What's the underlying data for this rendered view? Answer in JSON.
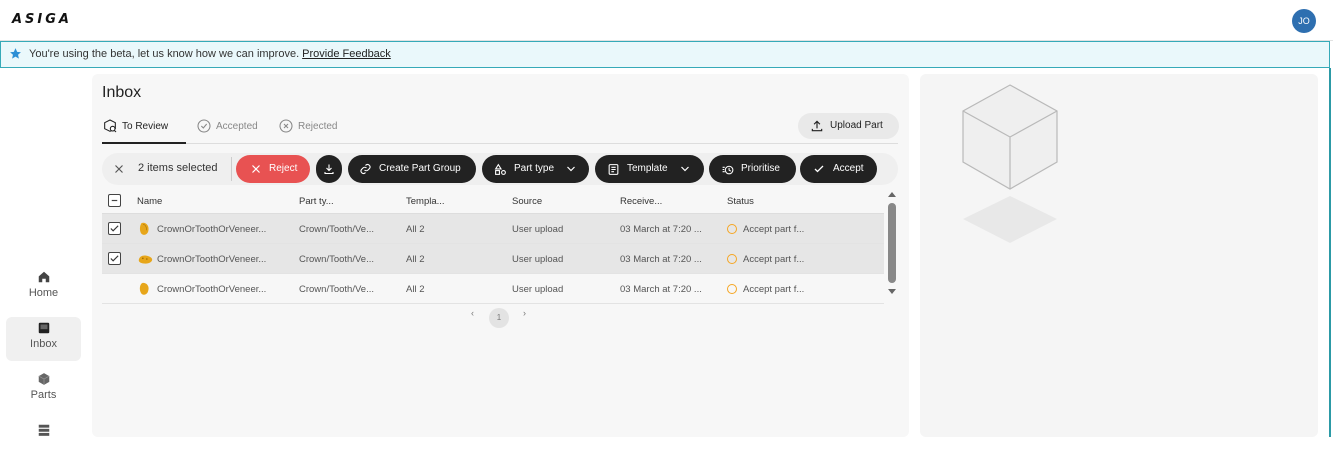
{
  "app": {
    "logo": "ASIGA",
    "user_initials": "JO"
  },
  "banner": {
    "message": "You're using the beta, let us know how we can improve.",
    "link": "Provide Feedback"
  },
  "sidebar": {
    "items": [
      {
        "label": "Home",
        "icon": "home-icon"
      },
      {
        "label": "Inbox",
        "icon": "inbox-icon",
        "active": true
      },
      {
        "label": "Parts",
        "icon": "cube-icon"
      },
      {
        "label": "",
        "icon": "server-icon"
      }
    ]
  },
  "main": {
    "title": "Inbox",
    "tabs": [
      {
        "label": "To Review",
        "active": true
      },
      {
        "label": "Accepted"
      },
      {
        "label": "Rejected"
      }
    ],
    "upload_label": "Upload Part",
    "actions": {
      "selected_count": "2 items selected",
      "reject": "Reject",
      "create_group": "Create Part Group",
      "part_type": "Part type",
      "template": "Template",
      "prioritise": "Prioritise",
      "accept": "Accept"
    },
    "table": {
      "headers": [
        "Name",
        "Part ty...",
        "Templa...",
        "Source",
        "Receive...",
        "Status"
      ],
      "rows": [
        {
          "name": "CrownOrToothOrVeneer...",
          "part_type": "Crown/Tooth/Ve...",
          "template": "All 2",
          "source": "User upload",
          "received": "03 March at 7:20 ...",
          "status": "Accept part f...",
          "checked": true
        },
        {
          "name": "CrownOrToothOrVeneer...",
          "part_type": "Crown/Tooth/Ve...",
          "template": "All 2",
          "source": "User upload",
          "received": "03 March at 7:20 ...",
          "status": "Accept part f...",
          "checked": true
        },
        {
          "name": "CrownOrToothOrVeneer...",
          "part_type": "Crown/Tooth/Ve...",
          "template": "All 2",
          "source": "User upload",
          "received": "03 March at 7:20 ...",
          "status": "Accept part f...",
          "checked": false
        }
      ]
    },
    "pagination": {
      "current": "1"
    }
  },
  "colors": {
    "accent": "#e85252",
    "dark": "#222222",
    "teal": "#36aab8",
    "status_pending": "#f5a623",
    "avatar": "#2e6fb0"
  }
}
